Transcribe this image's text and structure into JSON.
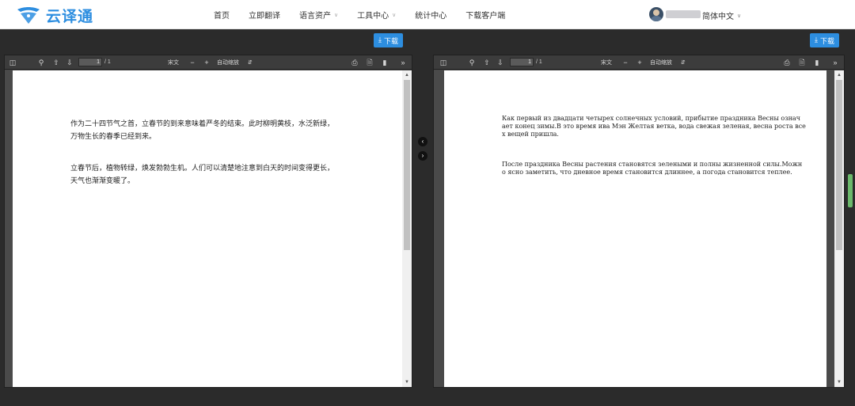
{
  "brand": {
    "name": "云译通",
    "color": "#2d8ee0"
  },
  "nav": {
    "items": [
      {
        "label": "首页",
        "dropdown": false
      },
      {
        "label": "立即翻译",
        "dropdown": false
      },
      {
        "label": "语言资产",
        "dropdown": true
      },
      {
        "label": "工具中心",
        "dropdown": true
      },
      {
        "label": "统计中心",
        "dropdown": false
      },
      {
        "label": "下载客户端",
        "dropdown": false
      }
    ],
    "language": "简体中文"
  },
  "left_panel": {
    "download_label": "下载",
    "toolbar": {
      "page": "1",
      "total": "/ 1",
      "font_label": "宋文",
      "zoom_label": "自动缩放"
    },
    "paragraphs": [
      [
        "作为二十四节气之首，立春节的到来意味着严冬的结束。此时柳明黄枝，水泛新绿，",
        "万物生长的春季已经到来。"
      ],
      [
        "立春节后，植物转绿，焕发勃勃生机。人们可以清楚地注意到白天的时间变得更长，",
        "天气也渐渐变暖了。"
      ]
    ]
  },
  "right_panel": {
    "download_label": "下载",
    "toolbar": {
      "page": "1",
      "total": "/ 1",
      "font_label": "宋文",
      "zoom_label": "自动缩放"
    },
    "paragraphs": [
      [
        "Как первый из двадцати четырех солнечных условий, прибытие праздника Весны означ",
        "ает конец зимы.В это время ива Мэн Желтая ветка, вода свежая зеленая, весна роста все",
        "х вещей пришла."
      ],
      [
        "После праздника Весны растения становятся зелеными и полны жизненной силы.Можн",
        "о ясно заметить, что дневное время становится длиннее, а погода становится теплее."
      ]
    ]
  },
  "icons": {
    "sidebar_toggle": "sidebar-toggle-icon",
    "search": "search-icon",
    "prev": "arrow-up-icon",
    "next": "arrow-down-icon",
    "zoom_out": "minus-icon",
    "zoom_in": "plus-icon",
    "print": "print-icon",
    "save": "save-icon",
    "bookmark": "bookmark-icon",
    "tools": "double-chevron-icon"
  }
}
